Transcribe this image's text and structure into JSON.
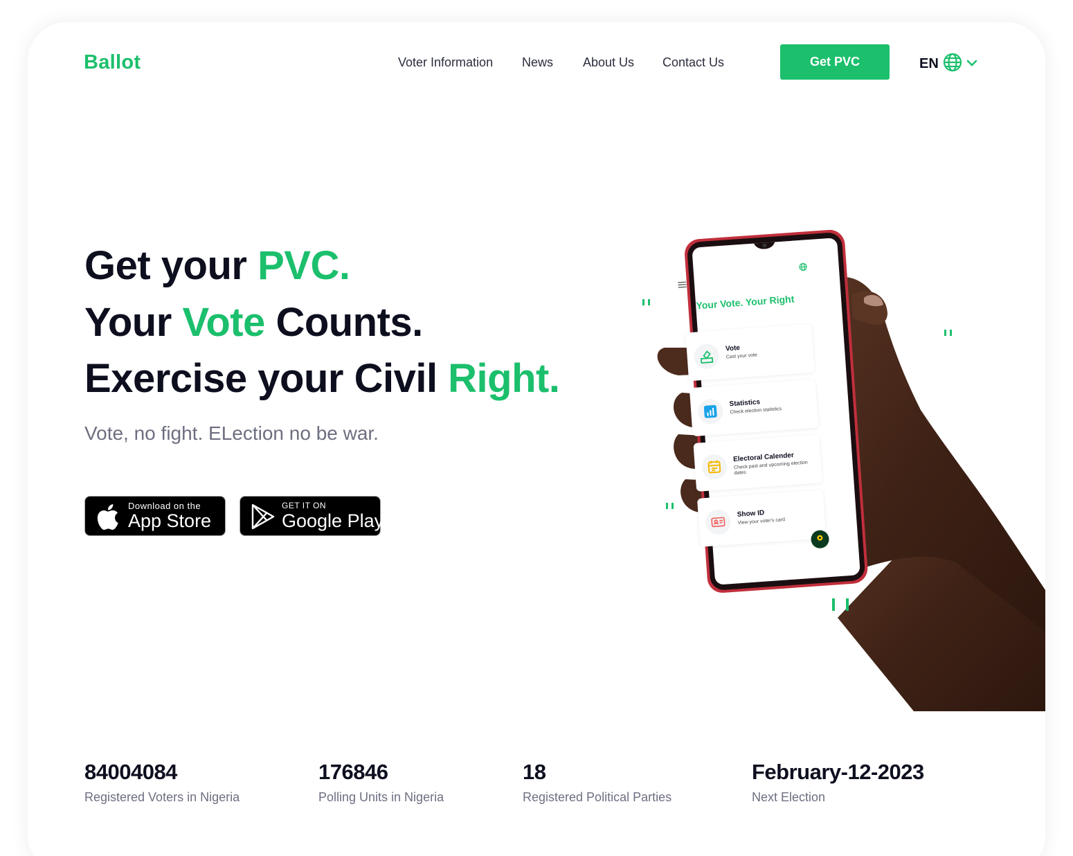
{
  "brand": {
    "name": "Ballot",
    "accent": "#1bbf6c",
    "dark": "#0d0f1f"
  },
  "nav": {
    "items": [
      {
        "label": "Voter Information"
      },
      {
        "label": "News"
      },
      {
        "label": "About Us"
      },
      {
        "label": "Contact Us"
      }
    ],
    "cta": "Get PVC",
    "language": {
      "code": "EN",
      "icon": "globe-icon",
      "dropdown_icon": "chevron-down-icon"
    }
  },
  "hero": {
    "line1": {
      "pre": "Get your ",
      "accent": "PVC."
    },
    "line2": {
      "pre": "Your ",
      "accent": "Vote",
      "post": " Counts."
    },
    "line3": {
      "pre": "Exercise your Civil ",
      "accent": "Right."
    },
    "subtitle": "Vote, no fight. ELection no be war."
  },
  "stores": {
    "app_store": {
      "small": "Download on the",
      "big": "App Store",
      "icon": "apple-icon"
    },
    "google_play": {
      "small": "GET IT ON",
      "big": "Google Play",
      "icon": "play-icon"
    }
  },
  "phone": {
    "title": "Your Vote. Your Right",
    "menu_icon": "menu-icon",
    "globe_icon": "globe-icon",
    "cards": [
      {
        "title": "Vote",
        "desc": "Cast your vote",
        "icon": "ballot-icon",
        "color": "#1bbf6c"
      },
      {
        "title": "Statistics",
        "desc": "Check election statistics",
        "icon": "chart-icon",
        "color": "#1aa3e8"
      },
      {
        "title": "Electoral Calender",
        "desc": "Check past and upcoming election dates",
        "icon": "calendar-icon",
        "color": "#f5b800"
      },
      {
        "title": "Show ID",
        "desc": "View your voter's card",
        "icon": "id-card-icon",
        "color": "#f05a5a"
      }
    ]
  },
  "stats": [
    {
      "value": "84004084",
      "label": "Registered Voters in Nigeria"
    },
    {
      "value": "176846",
      "label": "Polling Units in Nigeria"
    },
    {
      "value": "18",
      "label": "Registered Political Parties"
    },
    {
      "value": "February-12-2023",
      "label": "Next Election"
    }
  ]
}
